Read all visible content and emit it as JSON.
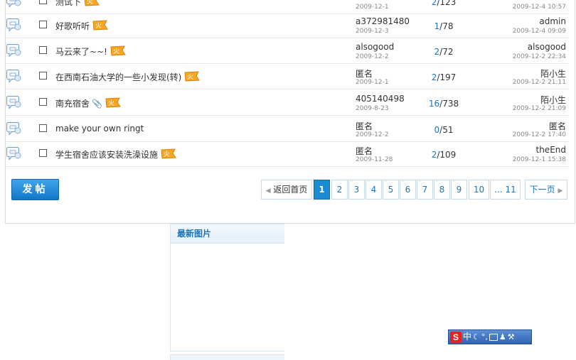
{
  "threads": [
    {
      "title": "测试下",
      "hot": true,
      "attach": false,
      "author": "",
      "author_date": "2009-12-1",
      "replies": "2",
      "views": "123",
      "last_user": "",
      "last_date": "2009-12-4 10:57"
    },
    {
      "title": "好歌听听",
      "hot": true,
      "attach": false,
      "author": "a372981480",
      "author_date": "2009-12-3",
      "replies": "1",
      "views": "78",
      "last_user": "admin",
      "last_date": "2009-12-4 09:09"
    },
    {
      "title": "马云来了~~!",
      "hot": true,
      "attach": false,
      "author": "alsogood",
      "author_date": "2009-12-2",
      "replies": "2",
      "views": "72",
      "last_user": "alsogood",
      "last_date": "2009-12-2 22:34"
    },
    {
      "title": "在西南石油大学的一些小发现(转)",
      "hot": true,
      "attach": false,
      "author": "匿名",
      "author_date": "2009-12-1",
      "replies": "2",
      "views": "197",
      "last_user": "陌小生",
      "last_date": "2009-12-2 21:11"
    },
    {
      "title": "南充宿舍",
      "hot": true,
      "attach": true,
      "author": "405140498",
      "author_date": "2009-8-23",
      "replies": "16",
      "views": "738",
      "last_user": "陌小生",
      "last_date": "2009-12-2 21:09"
    },
    {
      "title": "make your own ringt",
      "hot": false,
      "attach": false,
      "author": "匿名",
      "author_date": "2009-12-2",
      "replies": "0",
      "views": "51",
      "last_user": "匿名",
      "last_date": "2009-12-2 17:40"
    },
    {
      "title": "学生宿舍应该安装洗澡设施",
      "hot": true,
      "attach": false,
      "author": "匿名",
      "author_date": "2009-11-28",
      "replies": "2",
      "views": "109",
      "last_user": "theEnd",
      "last_date": "2009-12-1 15:38"
    }
  ],
  "post_button": "发帖",
  "pagination": {
    "home": "返回首页",
    "pages": [
      "1",
      "2",
      "3",
      "4",
      "5",
      "6",
      "7",
      "8",
      "9",
      "10",
      "... 11"
    ],
    "current": "1",
    "next": "下一页"
  },
  "latest_images": {
    "title": "最新图片"
  },
  "ime_toolbar": {
    "logo": "S",
    "mode": "中"
  },
  "colors": {
    "accent": "#1b75bb",
    "button": "#1276c9",
    "border": "#d6dde5"
  }
}
